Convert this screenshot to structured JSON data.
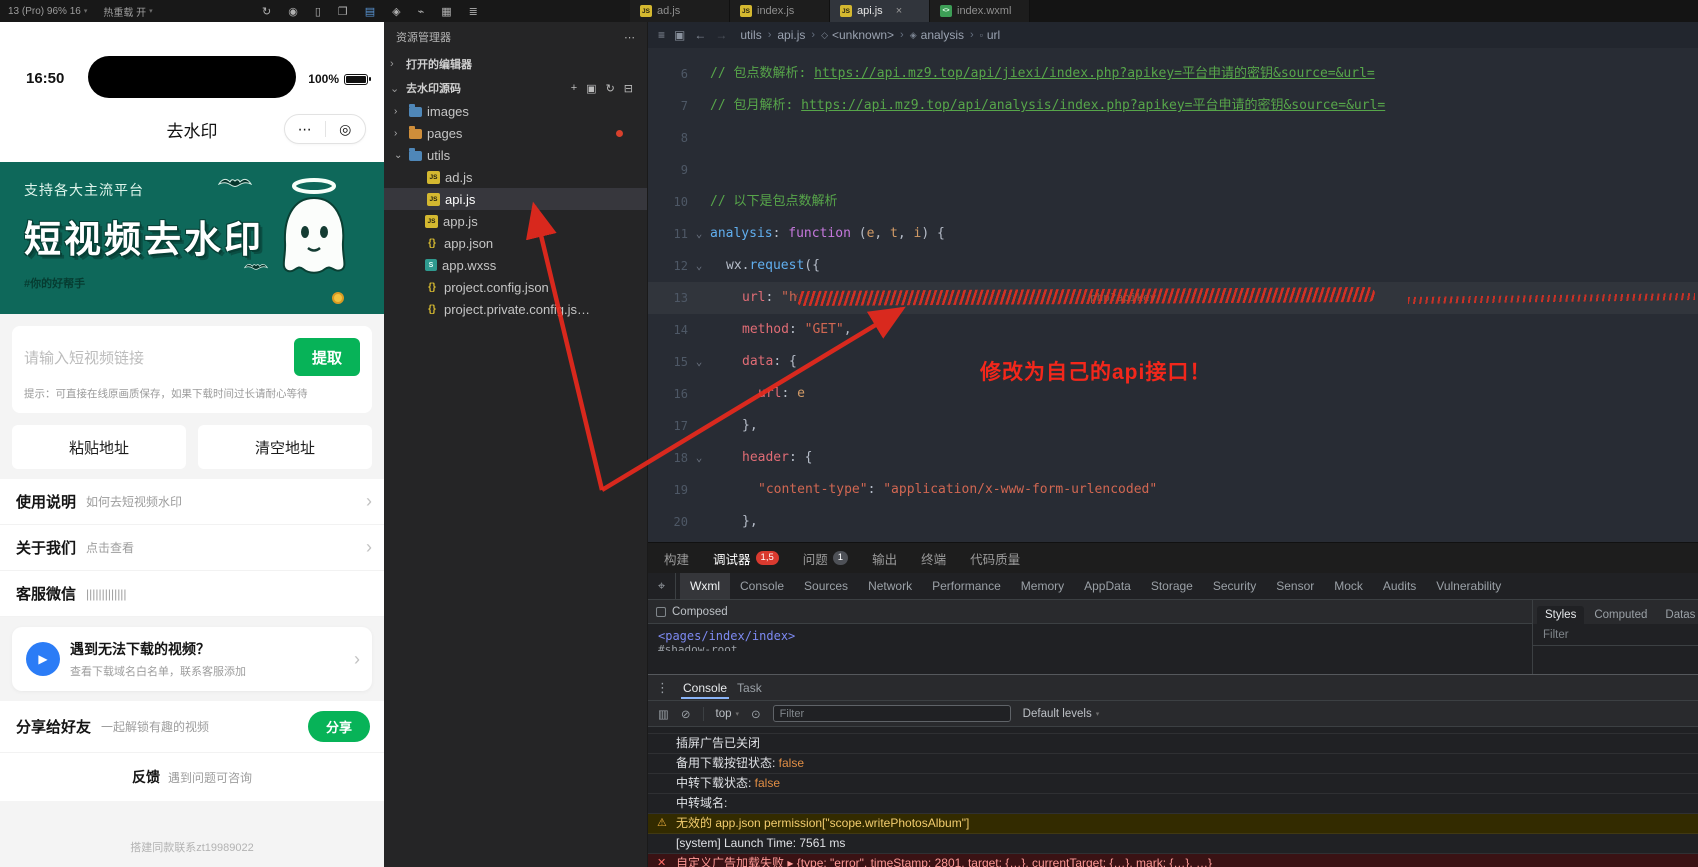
{
  "topbar": {
    "device": "13 (Pro) 96% 16",
    "hot_reload": "热重载 开",
    "icons": [
      {
        "name": "refresh-icon",
        "glyph": "↻"
      },
      {
        "name": "record-icon",
        "glyph": "◉"
      },
      {
        "name": "device-icon",
        "glyph": "▯"
      },
      {
        "name": "split-editor-icon",
        "glyph": "❐"
      },
      {
        "name": "compile-icon",
        "glyph": "▤"
      },
      {
        "name": "search-icon",
        "glyph": "◈"
      },
      {
        "name": "git-branch-icon",
        "glyph": "⌁"
      },
      {
        "name": "grid-icon",
        "glyph": "▦"
      },
      {
        "name": "menu-icon",
        "glyph": "≣"
      }
    ],
    "file_tabs": [
      {
        "label": "ad.js",
        "icon": "js"
      },
      {
        "label": "index.js",
        "icon": "js"
      },
      {
        "label": "api.js",
        "icon": "js",
        "active": true,
        "close": "×"
      },
      {
        "label": "index.wxml",
        "icon": "wxml"
      }
    ]
  },
  "simulator": {
    "status_time": "16:50",
    "battery_text": "100%",
    "nav_title": "去水印",
    "capsule": {
      "more": "⋯",
      "target": "◎"
    },
    "banner": {
      "line1": "支持各大主流平台",
      "title": "短视频去水印",
      "tag": "#你的好帮手"
    },
    "input_placeholder": "请输入短视频链接",
    "extract_btn": "提取",
    "hint": "提示：可直接在线原画质保存，如果下载时间过长请耐心等待",
    "paste_btn": "粘贴地址",
    "clear_btn": "清空地址",
    "list": [
      {
        "title": "使用说明",
        "desc": "如何去短视频水印",
        "chevron": "›"
      },
      {
        "title": "关于我们",
        "desc": "点击查看",
        "chevron": "›"
      },
      {
        "title": "客服微信",
        "desc": "|||||||||||||"
      }
    ],
    "help_card": {
      "title": "遇到无法下载的视频？",
      "desc": "查看下载域名白名单，联系客服添加",
      "chevron": "›",
      "icon": "▶"
    },
    "share": {
      "title": "分享给好友",
      "desc": "一起解锁有趣的视频",
      "btn": "分享"
    },
    "feedback": {
      "title": "反馈",
      "desc": "遇到问题可咨询"
    },
    "footer": "搭建同款联系zt19989022"
  },
  "explorer": {
    "title": "资源管理器",
    "more": "⋯",
    "sections": [
      "打开的编辑器",
      "去水印源码"
    ],
    "tools": [
      {
        "name": "new-file-icon",
        "glyph": "+"
      },
      {
        "name": "new-folder-icon",
        "glyph": "▣"
      },
      {
        "name": "refresh-icon",
        "glyph": "↻"
      },
      {
        "name": "collapse-icon",
        "glyph": "⊟"
      }
    ],
    "tree": [
      {
        "label": "images",
        "icon": "folder",
        "chev": "›",
        "indent": 0
      },
      {
        "label": "pages",
        "icon": "folder-orange",
        "chev": "›",
        "indent": 0,
        "dot": true
      },
      {
        "label": "utils",
        "icon": "folder",
        "chev": "⌄",
        "indent": 0
      },
      {
        "label": "ad.js",
        "icon": "js",
        "indent": 1,
        "file": true
      },
      {
        "label": "api.js",
        "icon": "js",
        "indent": 1,
        "file": true,
        "selected": true
      },
      {
        "label": "app.js",
        "icon": "js",
        "indent": 0,
        "file": true
      },
      {
        "label": "app.json",
        "icon": "json",
        "indent": 0,
        "file": true
      },
      {
        "label": "app.wxss",
        "icon": "wxss",
        "indent": 0,
        "file": true
      },
      {
        "label": "project.config.json",
        "icon": "json",
        "indent": 0,
        "file": true
      },
      {
        "label": "project.private.config.js…",
        "icon": "json",
        "indent": 0,
        "file": true
      }
    ]
  },
  "breadcrumb": {
    "icons": [
      {
        "name": "list-icon",
        "glyph": "≡"
      },
      {
        "name": "bookmark-icon",
        "glyph": "▣"
      },
      {
        "name": "back-icon",
        "glyph": "←"
      },
      {
        "name": "forward-icon",
        "glyph": "→",
        "dim": true
      }
    ],
    "items": [
      {
        "label": "utils"
      },
      {
        "label": "api.js"
      },
      {
        "label": "<unknown>",
        "sym": "◇"
      },
      {
        "label": "analysis",
        "sym": "◈"
      },
      {
        "label": "url",
        "sym": "▫"
      }
    ]
  },
  "editor": {
    "annotation": "修改为自己的api接口！",
    "scribble_remnant": "php?apikey",
    "lines": [
      {
        "n": "",
        "clip": true,
        "ind": 0,
        "tok": [
          [
            "cm",
            "// 包月解析: "
          ],
          [
            "lk",
            "https://api.mz9.top/api/analysis/index.php?apikey=平台申请的密钥&source=&url="
          ]
        ]
      },
      {
        "n": "6",
        "ind": 0,
        "tok": [
          [
            "cm",
            "// 包点数解析: "
          ],
          [
            "lk",
            "https://api.mz9.top/api/jiexi/index.php?apikey=平台申请的密钥&source=&url="
          ]
        ]
      },
      {
        "n": "7",
        "ind": 0,
        "tok": [
          [
            "cm",
            "// 包月解析: "
          ],
          [
            "lk",
            "https://api.mz9.top/api/analysis/index.php?apikey=平台申请的密钥&source=&url="
          ]
        ]
      },
      {
        "n": "8",
        "ind": 0,
        "tok": []
      },
      {
        "n": "9",
        "ind": 0,
        "tok": []
      },
      {
        "n": "10",
        "ind": 0,
        "tok": [
          [
            "cm",
            "// 以下是包点数解析"
          ]
        ]
      },
      {
        "n": "11",
        "fold": true,
        "ind": 0,
        "tok": [
          [
            "fn",
            "analysis"
          ],
          [
            "pl",
            ": "
          ],
          [
            "kw",
            "function "
          ],
          [
            "pl",
            "("
          ],
          [
            "pm",
            "e"
          ],
          [
            "pl",
            ", "
          ],
          [
            "pm",
            "t"
          ],
          [
            "pl",
            ", "
          ],
          [
            "pm",
            "i"
          ],
          [
            "pl",
            ") {"
          ]
        ]
      },
      {
        "n": "12",
        "fold": true,
        "ind": 1,
        "tok": [
          [
            "pl",
            "wx."
          ],
          [
            "fn",
            "request"
          ],
          [
            "pl",
            "({"
          ]
        ]
      },
      {
        "n": "13",
        "ind": 2,
        "scribble": true,
        "tok": [
          [
            "pr",
            "url"
          ],
          [
            "pl",
            ": "
          ],
          [
            "st",
            "\"h"
          ]
        ]
      },
      {
        "n": "14",
        "ind": 2,
        "tok": [
          [
            "pr",
            "method"
          ],
          [
            "pl",
            ": "
          ],
          [
            "st",
            "\"GET\""
          ],
          [
            "pl",
            ","
          ]
        ]
      },
      {
        "n": "15",
        "fold": true,
        "ind": 2,
        "tok": [
          [
            "pr",
            "data"
          ],
          [
            "pl",
            ": {"
          ]
        ]
      },
      {
        "n": "16",
        "ind": 3,
        "tok": [
          [
            "pr",
            "url"
          ],
          [
            "pl",
            ": "
          ],
          [
            "pm",
            "e"
          ]
        ]
      },
      {
        "n": "17",
        "ind": 2,
        "tok": [
          [
            "pl",
            "},"
          ]
        ]
      },
      {
        "n": "18",
        "fold": true,
        "ind": 2,
        "tok": [
          [
            "pr",
            "header"
          ],
          [
            "pl",
            ": {"
          ]
        ]
      },
      {
        "n": "19",
        "ind": 3,
        "tok": [
          [
            "st",
            "\"content-type\""
          ],
          [
            "pl",
            ": "
          ],
          [
            "st",
            "\"application/x-www-form-urlencoded\""
          ]
        ]
      },
      {
        "n": "20",
        "ind": 2,
        "tok": [
          [
            "pl",
            "},"
          ]
        ]
      }
    ]
  },
  "panel": {
    "tabs": [
      {
        "label": "构建"
      },
      {
        "label": "调试器",
        "active": true,
        "badge": "1,5",
        "badge_color": "red"
      },
      {
        "label": "问题",
        "badge": "1",
        "badge_color": "gray"
      },
      {
        "label": "输出"
      },
      {
        "label": "终端"
      },
      {
        "label": "代码质量"
      }
    ],
    "devtools_tabs": [
      "Wxml",
      "Console",
      "Sources",
      "Network",
      "Performance",
      "Memory",
      "AppData",
      "Storage",
      "Security",
      "Sensor",
      "Mock",
      "Audits",
      "Vulnerability"
    ],
    "devtools_active": "Wxml",
    "composed": "Composed",
    "element_tree": "<pages/index/index>",
    "element_tree_partial": "#shadow-root",
    "styles_tabs": [
      "Styles",
      "Computed",
      "Datas"
    ],
    "styles_active": "Styles",
    "styles_filter": "Filter",
    "drawer_tabs": [
      "Console",
      "Task"
    ],
    "drawer_active": "Console",
    "context": "top",
    "filter_placeholder": "Filter",
    "levels": "Default levels",
    "console_rows": [
      {
        "kind": "clip",
        "text": ""
      },
      {
        "kind": "log",
        "text": "插屏广告已关闭"
      },
      {
        "kind": "log",
        "text": "备用下载按钮状态: ",
        "value": "false"
      },
      {
        "kind": "log",
        "text": "中转下载状态: ",
        "value": "false"
      },
      {
        "kind": "log",
        "text": "中转域名:"
      },
      {
        "kind": "warn",
        "text": "无效的 app.json permission[\"scope.writePhotosAlbum\"]"
      },
      {
        "kind": "log",
        "text": "[system] Launch Time: 7561 ms"
      },
      {
        "kind": "error",
        "text": "自定义广告加载失败 ▸ {type: \"error\", timeStamp: 2801, target: {…}, currentTarget: {…}, mark: {…}, …}"
      }
    ]
  }
}
